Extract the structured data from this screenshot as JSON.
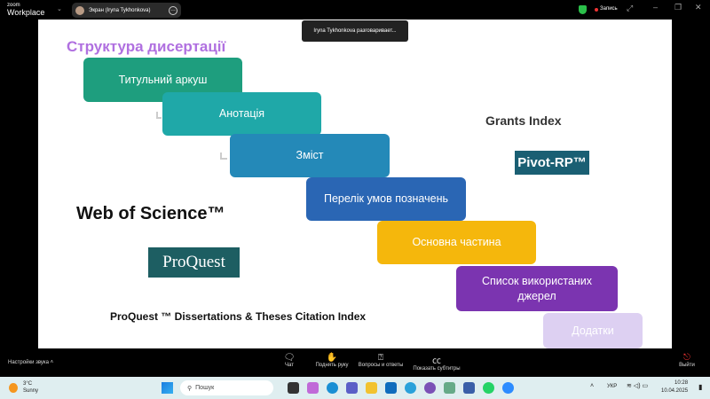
{
  "app": {
    "logo_top": "zoom",
    "logo_bottom": "Workplace",
    "share_label": "Экран (Iryna Tykhonkova)",
    "speaking_tip": "Iryna Tykhonkova разговаривает...",
    "record_label": "Запись"
  },
  "slide": {
    "title": "Структура дисертації",
    "steps": [
      {
        "label": "Титульний аркуш",
        "color": "#1e9e7e"
      },
      {
        "label": "Анотація",
        "color": "#1fa8a8"
      },
      {
        "label": "Зміст",
        "color": "#2489b8"
      },
      {
        "label": "Перелік умов позначень",
        "color": "#2a66b4"
      },
      {
        "label": "Основна частина",
        "color": "#f5b70c"
      },
      {
        "label": "Список використаних джерел",
        "color": "#7b34b0"
      },
      {
        "label": "Додатки",
        "color": "#ddd0f2"
      }
    ],
    "web_of_science": "Web of Science™",
    "proquest": "ProQuest",
    "proquest_index": "ProQuest ™ Dissertations & Theses Citation Index",
    "grants_index": "Grants Index",
    "pivot": "Pivot-RP™"
  },
  "toolbar": {
    "audio_settings": "Настройки звука",
    "chat": "Чат",
    "raise_hand": "Поднять руку",
    "qa": "Вопросы и ответы",
    "captions": "Показать субтитры",
    "leave": "Выйти"
  },
  "taskbar": {
    "temp": "3°C",
    "weather": "Sunny",
    "search": "Пошук",
    "lang": "УКР",
    "time": "10:28",
    "date": "10.04.2025"
  }
}
